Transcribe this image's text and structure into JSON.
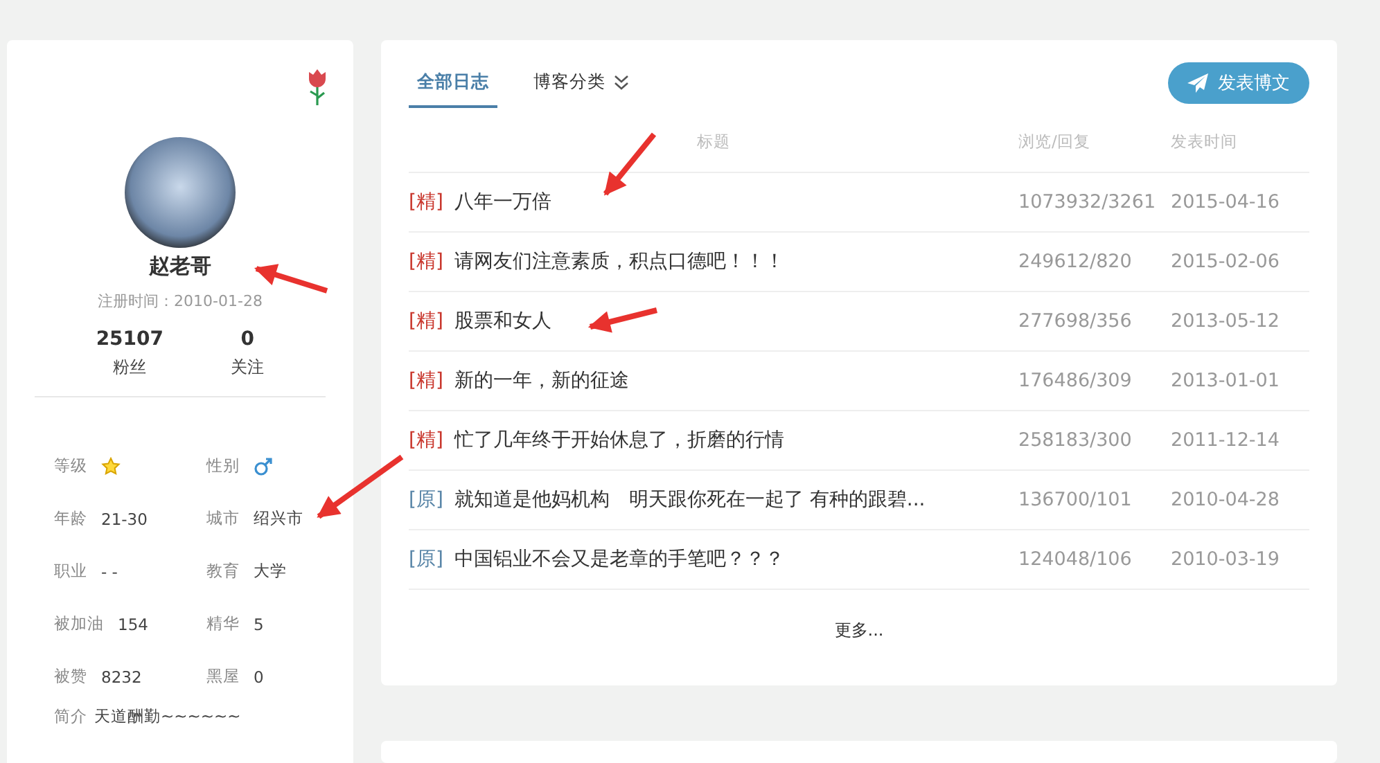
{
  "profile": {
    "name": "赵老哥",
    "registered": "注册时间：2010-01-28",
    "stats": [
      {
        "value": "25107",
        "label": "粉丝"
      },
      {
        "value": "0",
        "label": "关注"
      }
    ],
    "details": [
      {
        "label": "等级",
        "kind": "star"
      },
      {
        "label": "性别",
        "kind": "male"
      },
      {
        "label": "年龄",
        "kind": "text",
        "value": "21-30"
      },
      {
        "label": "城市",
        "kind": "text",
        "value": "绍兴市"
      },
      {
        "label": "职业",
        "kind": "text",
        "value": "- -"
      },
      {
        "label": "教育",
        "kind": "text",
        "value": "大学"
      },
      {
        "label": "被加油",
        "kind": "text",
        "value": "154"
      },
      {
        "label": "精华",
        "kind": "text",
        "value": "5"
      },
      {
        "label": "被赞",
        "kind": "text",
        "value": "8232"
      },
      {
        "label": "黑屋",
        "kind": "text",
        "value": "0"
      }
    ],
    "bio": {
      "label": "简介",
      "value": "天道酬勤~~~~~~"
    }
  },
  "blog": {
    "tabs": [
      {
        "label": "全部日志",
        "selected": true
      },
      {
        "label": "博客分类",
        "selected": false
      }
    ],
    "post_button": "发表博文",
    "columns": [
      "标题",
      "浏览/回复",
      "发表时间"
    ],
    "rows": [
      {
        "kind": "featured",
        "tag": "[精]",
        "title": "八年一万倍",
        "views": "1073932/3261",
        "date": "2015-04-16"
      },
      {
        "kind": "featured",
        "tag": "[精]",
        "title": "请网友们注意素质，积点口德吧！！！",
        "views": "249612/820",
        "date": "2015-02-06"
      },
      {
        "kind": "featured",
        "tag": "[精]",
        "title": "股票和女人",
        "views": "277698/356",
        "date": "2013-05-12"
      },
      {
        "kind": "featured",
        "tag": "[精]",
        "title": "新的一年，新的征途",
        "views": "176486/309",
        "date": "2013-01-01"
      },
      {
        "kind": "featured",
        "tag": "[精]",
        "title": "忙了几年终于开始休息了，折磨的行情",
        "views": "258183/300",
        "date": "2011-12-14"
      },
      {
        "kind": "original",
        "tag": "[原]",
        "title": "就知道是他妈机构　明天跟你死在一起了  有种的跟碧...",
        "views": "136700/101",
        "date": "2010-04-28"
      },
      {
        "kind": "original",
        "tag": "[原]",
        "title": "中国铝业不会又是老章的手笔吧？？？",
        "views": "124048/106",
        "date": "2010-03-19"
      }
    ],
    "more": "更多..."
  }
}
